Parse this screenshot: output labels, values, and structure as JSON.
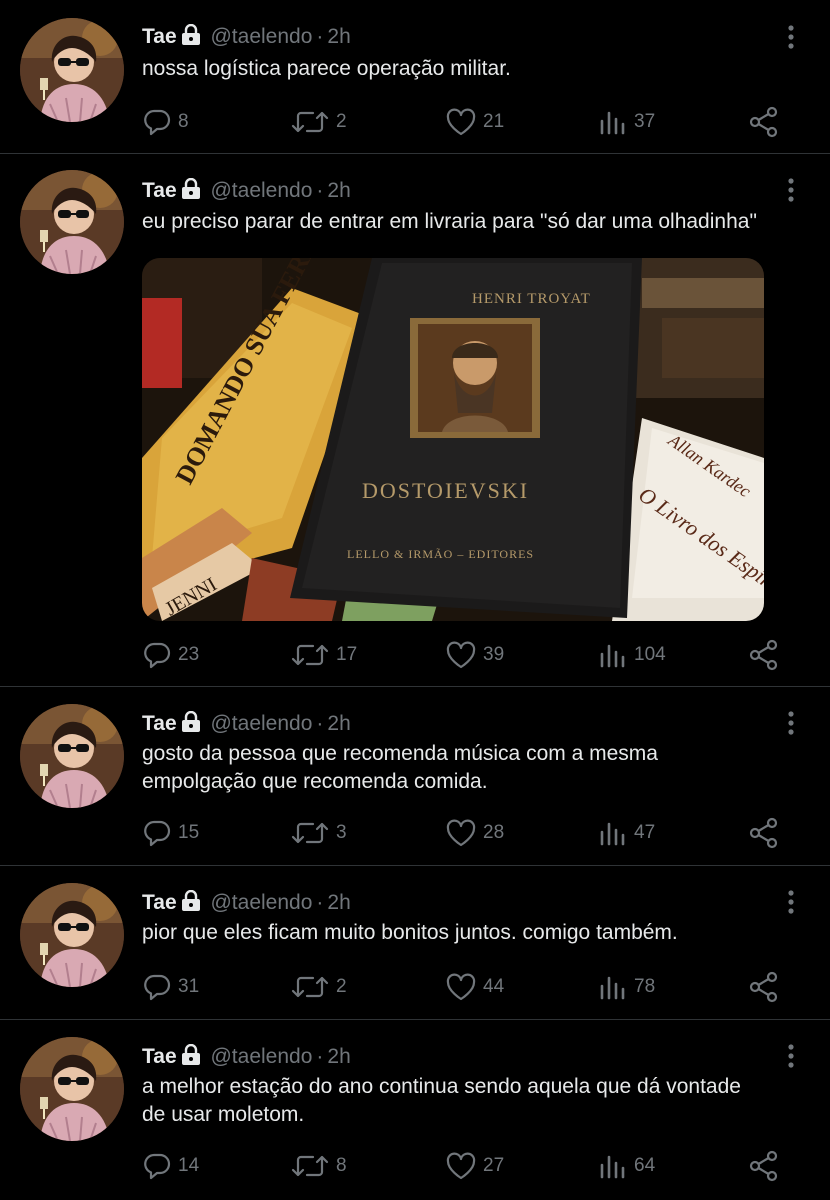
{
  "tweets": [
    {
      "name": "Tae",
      "handle": "@taelendo",
      "time": "2h",
      "text": "nossa logística parece operação militar.",
      "replies": "8",
      "retweets": "2",
      "likes": "21",
      "views": "37"
    },
    {
      "name": "Tae",
      "handle": "@taelendo",
      "time": "2h",
      "text": "eu preciso parar de entrar em livraria para \"só dar uma olhadinha\"",
      "replies": "23",
      "retweets": "17",
      "likes": "39",
      "views": "104",
      "media": {
        "book_main_title": "DOSTOIEVSKI",
        "book_main_author": "HENRI TROYAT",
        "book_main_publisher": "LELLO & IRMÃO – EDITORES",
        "book_left_title": "DOMANDO SUA FERINHA",
        "book_right_author": "Allan Kardec",
        "book_right_title": "O Livro dos Espíritos",
        "spine_text": "JENNI"
      }
    },
    {
      "name": "Tae",
      "handle": "@taelendo",
      "time": "2h",
      "text_line1": "gosto da pessoa que recomenda música com a mesma",
      "text_line2": "empolgação que recomenda comida.",
      "replies": "15",
      "retweets": "3",
      "likes": "28",
      "views": "47"
    },
    {
      "name": "Tae",
      "handle": "@taelendo",
      "time": "2h",
      "text": "pior que eles ficam muito bonitos juntos. comigo também.",
      "replies": "31",
      "retweets": "2",
      "likes": "44",
      "views": "78"
    },
    {
      "name": "Tae",
      "handle": "@taelendo",
      "time": "2h",
      "text_line1": "a melhor estação do ano continua sendo aquela que dá vontade",
      "text_line2": "de usar moletom.",
      "replies": "14",
      "retweets": "8",
      "likes": "27",
      "views": "64"
    }
  ],
  "colors": {
    "background": "#000000",
    "text": "#e7e9ea",
    "secondary": "#71767b",
    "divider": "#2f3336"
  },
  "icons": [
    "lock-icon",
    "more-icon",
    "reply-icon",
    "retweet-icon",
    "like-icon",
    "views-icon",
    "share-icon"
  ]
}
